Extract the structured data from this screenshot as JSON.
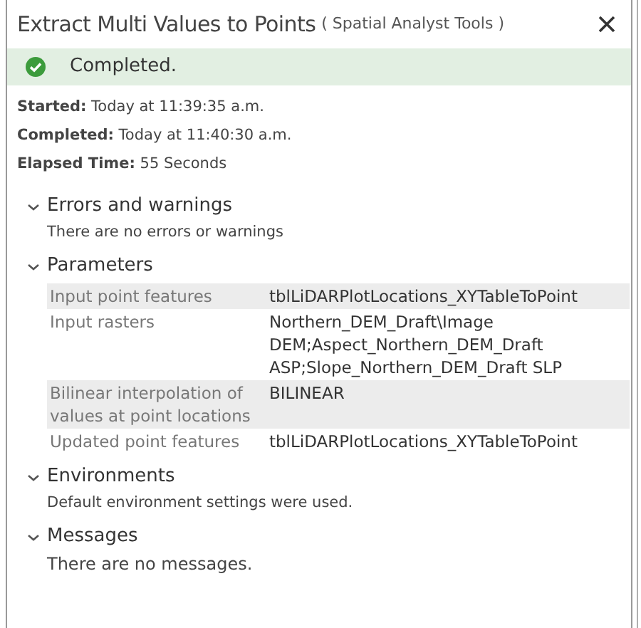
{
  "window": {
    "title": "Extract Multi Values to Points",
    "subtitle": "( Spatial Analyst Tools )"
  },
  "status": {
    "kind": "success",
    "text": "Completed."
  },
  "details": [
    {
      "label": "Started:",
      "value": "Today at 11:39:35 a.m."
    },
    {
      "label": "Completed:",
      "value": "Today at 11:40:30 a.m."
    },
    {
      "label": "Elapsed Time:",
      "value": "55 Seconds"
    }
  ],
  "sections": [
    {
      "title": "Errors and warnings",
      "expanded": true,
      "kind": "note",
      "text": "There are no errors or warnings"
    },
    {
      "title": "Parameters",
      "expanded": true,
      "kind": "table",
      "rows": [
        {
          "name": "Input point features",
          "value": "tblLiDARPlotLocations_XYTableToPoint"
        },
        {
          "name": "Input rasters",
          "value": "Northern_DEM_Draft\\Image DEM;Aspect_Northern_DEM_Draft ASP;Slope_Northern_DEM_Draft SLP"
        },
        {
          "name": "Bilinear interpolation of values at point locations",
          "value": "BILINEAR"
        },
        {
          "name": "Updated point features",
          "value": "tblLiDARPlotLocations_XYTableToPoint"
        }
      ]
    },
    {
      "title": "Environments",
      "expanded": true,
      "kind": "note",
      "text": "Default environment settings were used."
    },
    {
      "title": "Messages",
      "expanded": true,
      "kind": "message",
      "text": "There are no messages."
    }
  ]
}
